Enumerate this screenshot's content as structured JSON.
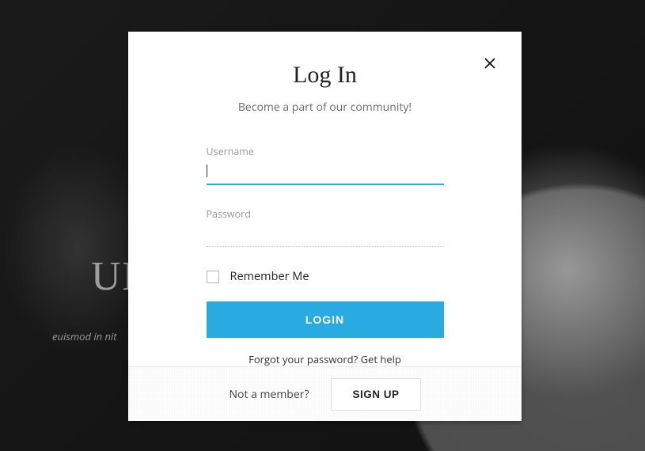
{
  "background": {
    "visible_title_fragment": "UE",
    "visible_caption_fragment": "euismod in nit"
  },
  "modal": {
    "title": "Log In",
    "subtitle": "Become a part of our community!",
    "fields": {
      "username": {
        "label": "Username",
        "value": ""
      },
      "password": {
        "label": "Password",
        "value": ""
      }
    },
    "remember_label": "Remember Me",
    "login_button": "LOGIN",
    "forgot_text": "Forgot your password? Get help",
    "footer": {
      "prompt": "Not a member?",
      "signup_button": "SIGN UP"
    }
  }
}
